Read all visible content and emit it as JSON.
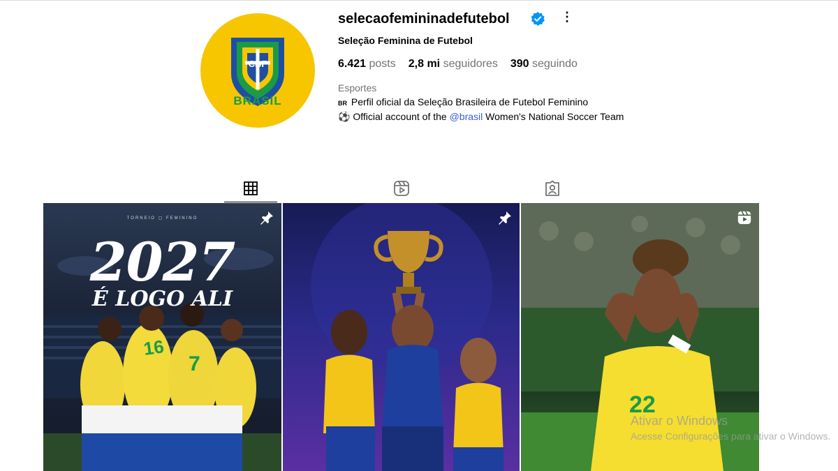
{
  "profile": {
    "username": "selecaofemininadefutebol",
    "full_name": "Seleção Feminina de Futebol",
    "avatar_text_top": "CBF",
    "avatar_text_bottom": "BRASIL",
    "more_glyph": "⋮",
    "stats": {
      "posts_count": "6.421",
      "posts_label": "posts",
      "followers_count": "2,8 mi",
      "followers_label": "seguidores",
      "following_count": "390",
      "following_label": "seguindo"
    },
    "category": "Esportes",
    "bio_line1_flag": "BR",
    "bio_line1": "Perfil oficial da Seleção Brasileira de Futebol Feminino",
    "bio_line2_prefix": "⚽ Official account of the ",
    "bio_line2_mention": "@brasil",
    "bio_line2_suffix": " Women's National Soccer Team"
  },
  "tabs": [
    {
      "name": "posts",
      "icon": "grid-icon",
      "active": true
    },
    {
      "name": "reels",
      "icon": "reels-icon",
      "active": false
    },
    {
      "name": "tagged",
      "icon": "tagged-icon",
      "active": false
    }
  ],
  "posts": [
    {
      "headline_year": "2027",
      "headline_sub": "É LOGO ALI",
      "strip": "TORNEIO ▢ FEMININO",
      "badge": "pin-icon"
    },
    {
      "badge": "pin-icon"
    },
    {
      "badge": "reels-icon"
    }
  ],
  "watermark": {
    "title": "Ativar o Windows",
    "subtitle": "Acesse Configurações para ativar o Windows."
  },
  "colors": {
    "verified": "#0095f6",
    "avatar_bg": "#f7c600",
    "mention": "#3b5bdb",
    "muted": "#737373"
  }
}
